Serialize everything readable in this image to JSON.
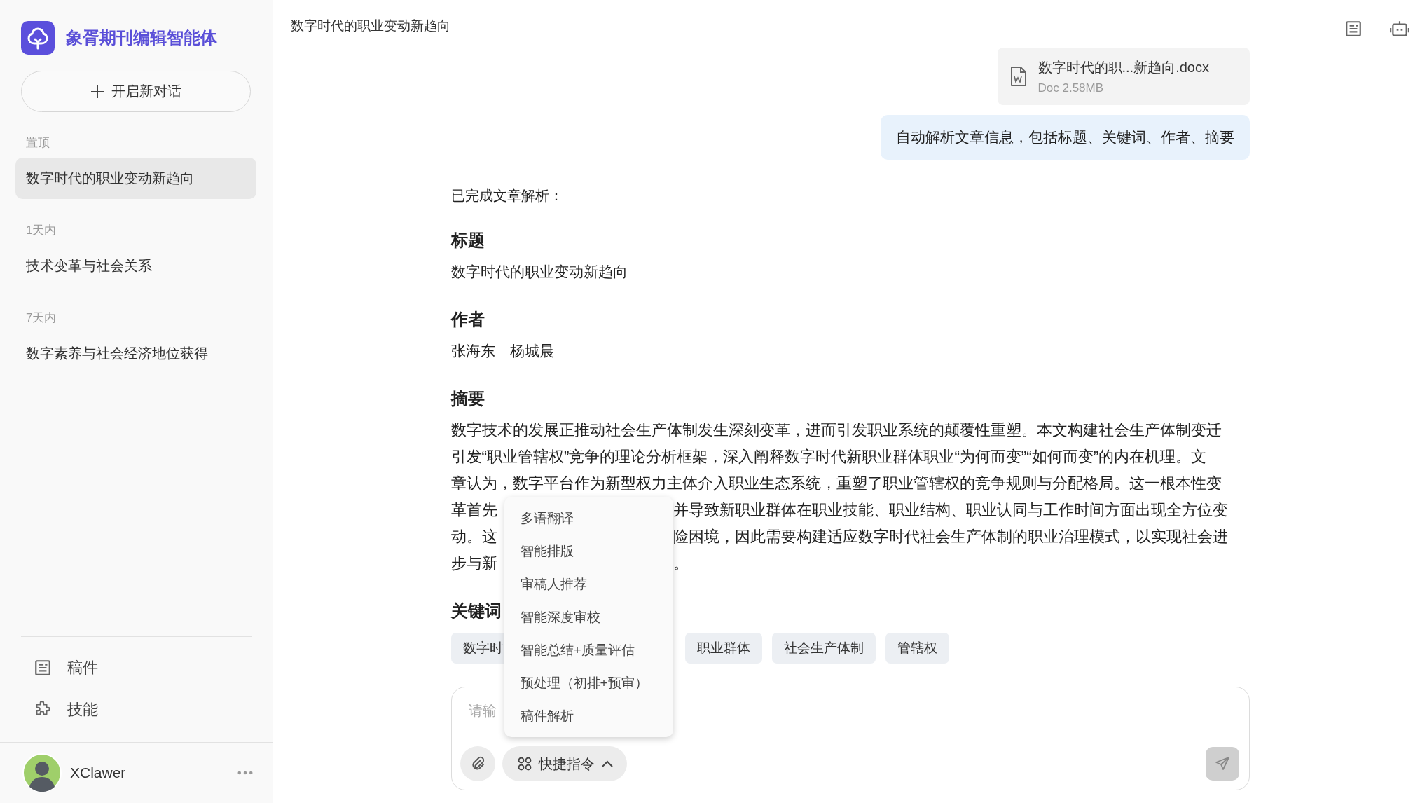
{
  "sidebar": {
    "app_name": "象胥期刊编辑智能体",
    "new_chat": "开启新对话",
    "groups": [
      {
        "label": "置顶",
        "items": [
          {
            "title": "数字时代的职业变动新趋向",
            "selected": true
          }
        ]
      },
      {
        "label": "1天内",
        "items": [
          {
            "title": "技术变革与社会关系",
            "selected": false
          }
        ]
      },
      {
        "label": "7天内",
        "items": [
          {
            "title": "数字素养与社会经济地位获得",
            "selected": false
          }
        ]
      }
    ],
    "nav": [
      {
        "label": "稿件",
        "kind": "manuscripts"
      },
      {
        "label": "技能",
        "kind": "skills"
      }
    ],
    "user": {
      "name": "XClawer"
    }
  },
  "header": {
    "title": "数字时代的职业变动新趋向"
  },
  "conversation": {
    "attachment": {
      "name": "数字时代的职...新趋向.docx",
      "meta": "Doc 2.58MB"
    },
    "user_message": "自动解析文章信息，包括标题、关键词、作者、摘要",
    "reply": {
      "intro": "已完成文章解析：",
      "sections": [
        {
          "heading": "标题",
          "text": "数字时代的职业变动新趋向"
        },
        {
          "heading": "作者",
          "text": "张海东　杨城晨"
        }
      ],
      "abstract_heading": "摘要",
      "abstract_lines": [
        {
          "text": "数字技术的发展正推动社会生产体制发生深刻变革，进而引发职业系统的颠覆性重塑。本文构建社会生产体制变迁"
        },
        {
          "text": "引发“职业管辖权”竞争的理论分析框架，深入阐释数字时代新职业群体职业“为何而变”“如何而变”的内在机理。文"
        },
        {
          "text": "章认为，数字平台作为新型权力主体介入职业生态系统，重塑了职业管辖权的竞争规则与分配格局。这一根本性变"
        },
        {
          "left": "革首先",
          "right": "并导致新职业群体在职业技能、职业结构、职业认同与工作时间方面出现全方位变"
        },
        {
          "left": "动。这",
          "right": "险困境，因此需要构建适应数字时代社会生产体制的职业治理模式，以实现社会进"
        },
        {
          "left": "步与新",
          "right": "。"
        }
      ],
      "keywords_heading": "关键词",
      "keywords": [
        "数字时",
        "职业群体",
        "社会生产体制",
        "管辖权"
      ]
    }
  },
  "composer": {
    "placeholder": "请输",
    "quick_commands": {
      "label": "快捷指令",
      "expanded": true,
      "items": [
        "多语翻译",
        "智能排版",
        "审稿人推荐",
        "智能深度审校",
        "智能总结+质量评估",
        "预处理（初排+预审）",
        "稿件解析"
      ]
    }
  }
}
